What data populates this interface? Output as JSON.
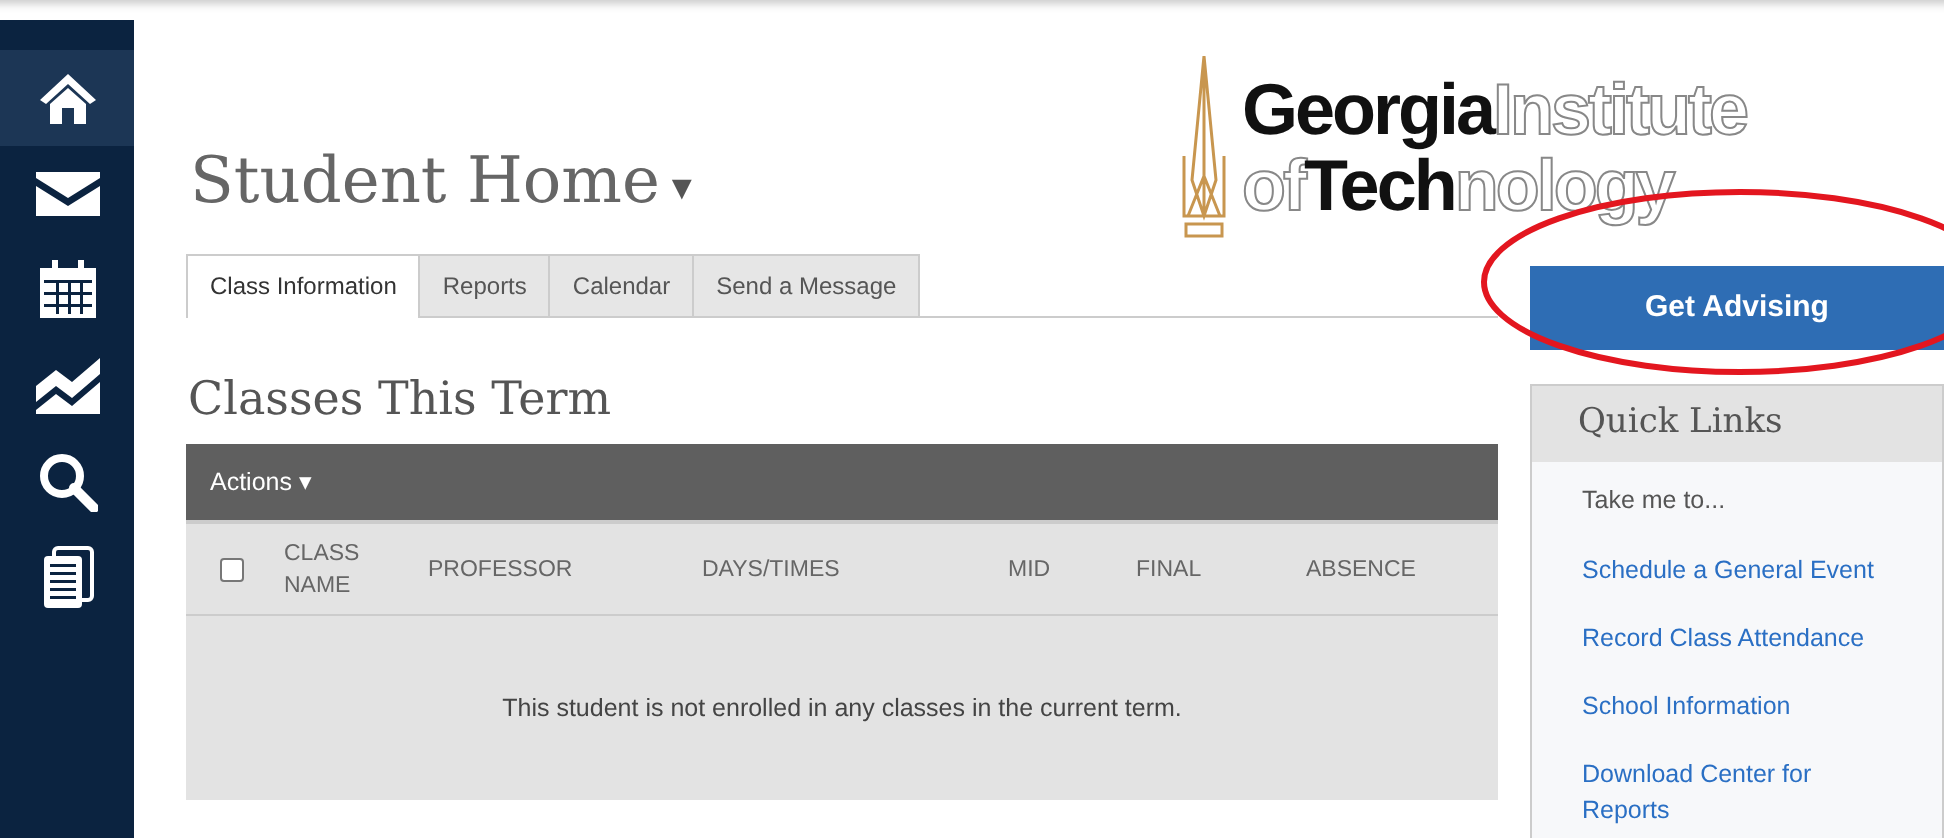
{
  "sidebar": {
    "items": [
      {
        "selected": true
      },
      {
        "selected": false
      },
      {
        "selected": false
      },
      {
        "selected": false
      },
      {
        "selected": false
      },
      {
        "selected": false
      }
    ]
  },
  "page_title": {
    "text": "Student Home",
    "caret": "▾"
  },
  "logo": {
    "lines": [
      [
        {
          "text": "Georgia",
          "kind": "solid"
        },
        {
          "text": "Institute",
          "kind": "outline"
        }
      ],
      [
        {
          "text": "of",
          "kind": "outline"
        },
        {
          "text": "Tech",
          "kind": "solid"
        },
        {
          "text": "nology",
          "kind": "outline"
        }
      ]
    ]
  },
  "tabs": [
    {
      "label": "Class Information",
      "selected": true
    },
    {
      "label": "Reports",
      "selected": false
    },
    {
      "label": "Calendar",
      "selected": false
    },
    {
      "label": "Send a Message",
      "selected": false
    }
  ],
  "section_title": "Classes This Term",
  "table": {
    "actions": "Actions",
    "actions_caret": "▾",
    "select_all_checked": false,
    "columns": [
      "CLASS NAME",
      "PROFESSOR",
      "DAYS/TIMES",
      "MID",
      "FINAL",
      "ABSENCE"
    ],
    "empty_message": "This student is not enrolled in any classes in the current term."
  },
  "advising_button": "Get Advising",
  "annotation": {
    "kind": "ellipse",
    "color": "#e3161f"
  },
  "quick_links": {
    "title": "Quick Links",
    "intro": "Take me to...",
    "links": [
      "Schedule a General Event",
      "Record Class Attendance",
      "School Information",
      "Download Center for Reports"
    ]
  }
}
